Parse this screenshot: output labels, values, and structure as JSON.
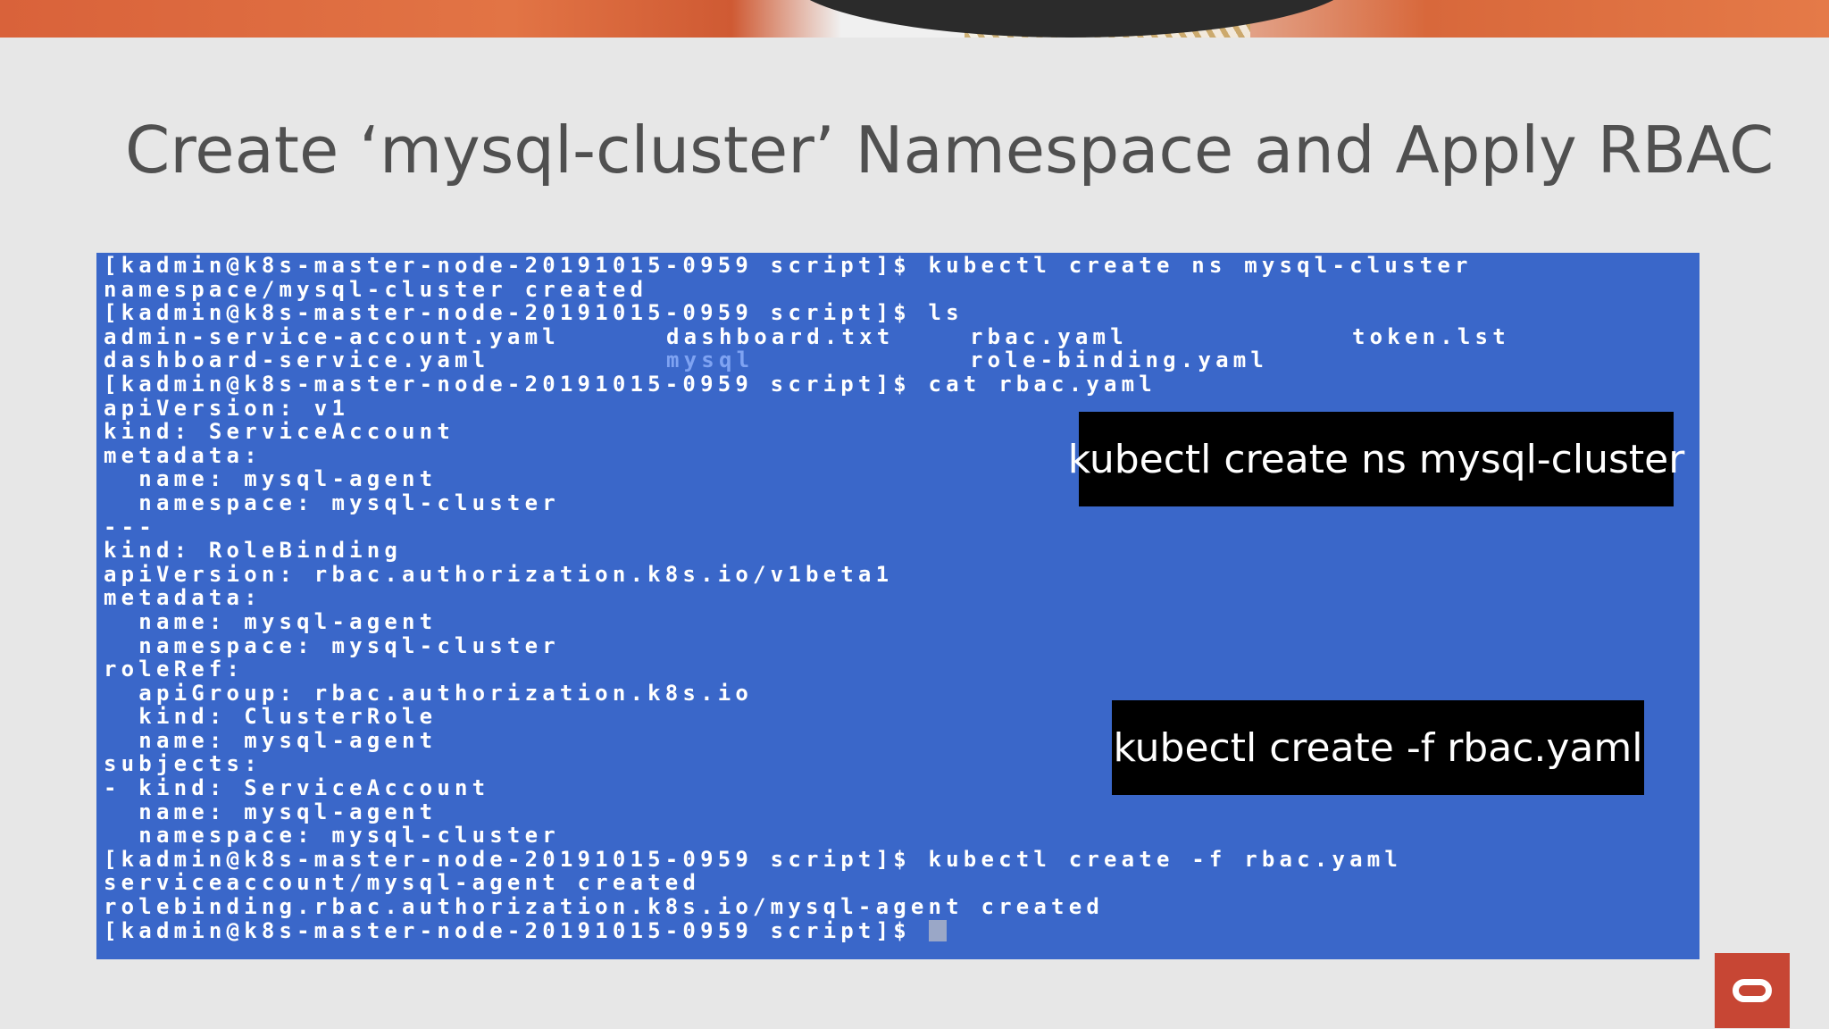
{
  "slide": {
    "title": "Create ‘mysql-cluster’ Namespace and Apply RBAC"
  },
  "terminal": {
    "lines": [
      "[kadmin@k8s-master-node-20191015-0959 script]$ kubectl create ns mysql-cluster",
      "namespace/mysql-cluster created",
      "[kadmin@k8s-master-node-20191015-0959 script]$ ls",
      "",
      "",
      "[kadmin@k8s-master-node-20191015-0959 script]$ cat rbac.yaml",
      "apiVersion: v1",
      "kind: ServiceAccount",
      "metadata:",
      "  name: mysql-agent",
      "  namespace: mysql-cluster",
      "---",
      "kind: RoleBinding",
      "apiVersion: rbac.authorization.k8s.io/v1beta1",
      "metadata:",
      "  name: mysql-agent",
      "  namespace: mysql-cluster",
      "roleRef:",
      "  apiGroup: rbac.authorization.k8s.io",
      "  kind: ClusterRole",
      "  name: mysql-agent",
      "subjects:",
      "- kind: ServiceAccount",
      "  name: mysql-agent",
      "  namespace: mysql-cluster",
      "[kadmin@k8s-master-node-20191015-0959 script]$ kubectl create -f rbac.yaml",
      "serviceaccount/mysql-agent created",
      "rolebinding.rbac.authorization.k8s.io/mysql-agent created",
      "[kadmin@k8s-master-node-20191015-0959 script]$ "
    ],
    "ls_output": [
      [
        "admin-service-account.yaml",
        "dashboard.txt",
        "rbac.yaml",
        "token.lst"
      ],
      [
        "dashboard-service.yaml",
        "mysql",
        "role-binding.yaml",
        ""
      ]
    ],
    "directory_color": "#7fa3f2",
    "background_color": "#3a67c9"
  },
  "callouts": {
    "first": "kubectl create ns mysql-cluster",
    "second": "kubectl create -f rbac.yaml"
  },
  "brand": {
    "logo_icon": "oracle-logo-icon",
    "logo_color": "#c74634"
  }
}
